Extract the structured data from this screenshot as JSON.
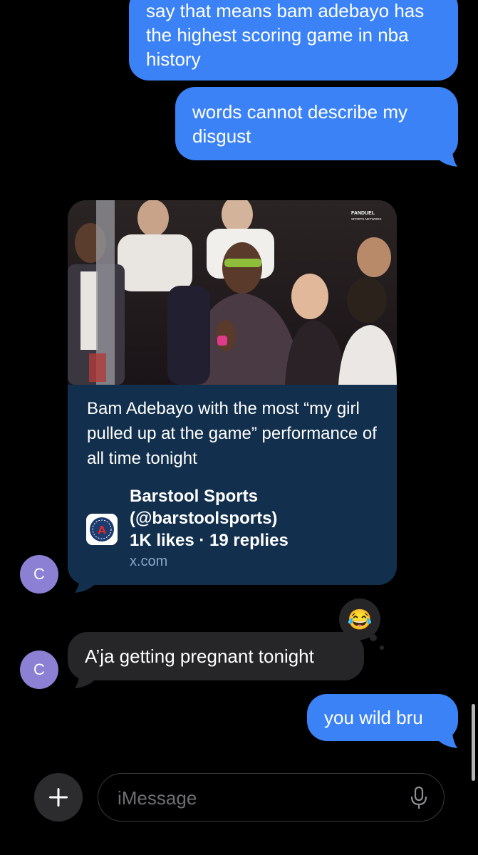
{
  "messages": {
    "out1": "say that means bam adebayo has the highest scoring game in nba history",
    "out2": "words cannot describe my disgust",
    "in_text": "A’ja getting pregnant tonight",
    "out3": "you wild bru"
  },
  "link_card": {
    "title": "Bam Adebayo with the most “my girl pulled up at the game” performance of all time tonight",
    "source_name": "Barstool Sports (@barstoolsports)",
    "stats": "1K likes · 19 replies",
    "domain": "x.com",
    "watermark": "FANDUEL",
    "watermark_sub": "SPORTS NETWORK"
  },
  "contact": {
    "initial": "C"
  },
  "reaction": {
    "emoji": "😂"
  },
  "composer": {
    "placeholder": "iMessage",
    "plus_label": "+"
  },
  "colors": {
    "outgoing_bubble": "#3b82f6",
    "incoming_bubble": "#262628",
    "card_background": "#12304d",
    "avatar": "#8b80d4"
  },
  "icons": [
    "plus-icon",
    "microphone-icon",
    "barstool-logo-icon",
    "fanduel-logo-icon"
  ]
}
